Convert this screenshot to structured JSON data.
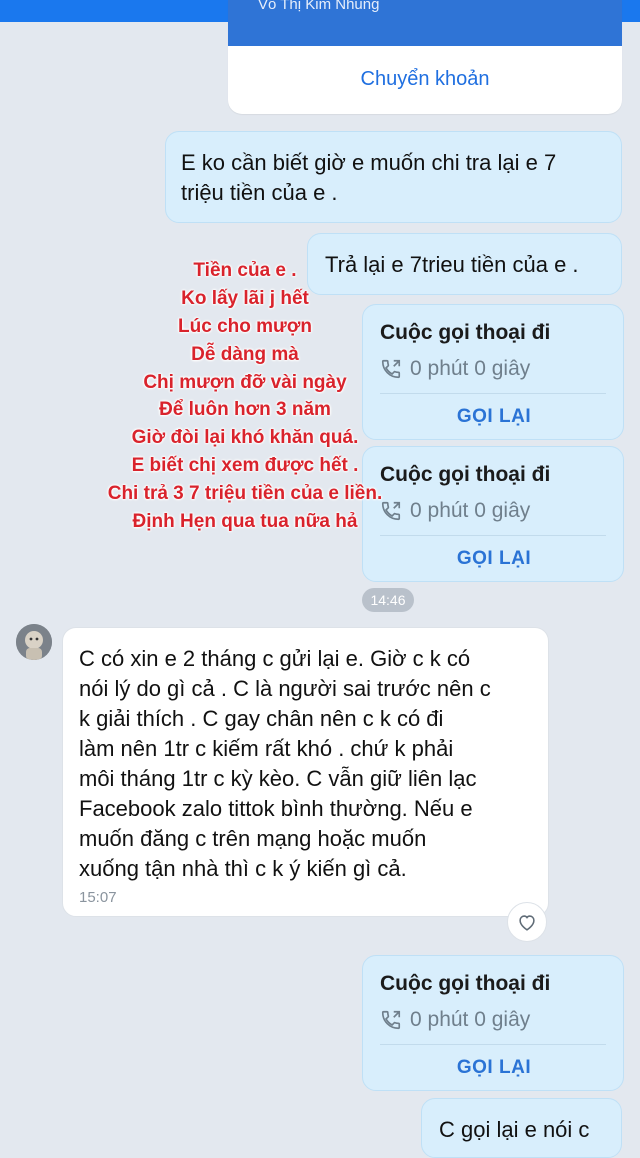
{
  "top_bar": {
    "cut_text": ""
  },
  "transfer": {
    "header_text": "Võ Thị Kim Nhung",
    "action_label": "Chuyển khoản"
  },
  "messages": {
    "m1": {
      "line1": "E ko cần biết giờ e muốn chi tra lại e 7",
      "line2": "triệu tiền của e ."
    },
    "m2": {
      "text": "Trả lại e 7trieu tiền của e ."
    },
    "call1": {
      "title": "Cuộc gọi thoại đi",
      "duration": "0 phút 0 giây",
      "action": "GỌI LẠI"
    },
    "call2": {
      "title": "Cuộc gọi thoại đi",
      "duration": "0 phút 0 giây",
      "action": "GỌI LẠI"
    },
    "time_badge": "14:46",
    "received": {
      "lines": [
        "C có xin e 2 tháng c gửi lại e. Giờ c k có",
        "nói lý do gì cả . C là người sai trước nên c",
        "k giải thích . C gay chân nên c k có đi",
        "làm nên 1tr c kiếm rất khó . chứ k phải",
        "môi tháng 1tr c kỳ kèo.  C vẫn giữ liên lạc",
        "Facebook zalo tittok bình thường. Nếu e",
        "muốn đăng c trên mạng hoặc muốn",
        "xuống tận nhà thì c k ý kiến gì cả."
      ],
      "time": "15:07"
    },
    "call3": {
      "title": "Cuộc gọi thoại đi",
      "duration": "0 phút 0 giây",
      "action": "GỌI LẠI"
    },
    "partial": {
      "text": "C gọi lại e nói c"
    }
  },
  "overlay": {
    "lines": [
      "Tiền của e .",
      "Ko lấy lãi j hết",
      "Lúc cho mượn",
      "Dễ dàng mà",
      "Chị mượn đỡ vài ngày",
      "Để luôn hơn 3 năm",
      "Giờ đòi lại khó khăn quá.",
      "E biết chị xem được hết .",
      "Chi trả 3 7 triệu tiền của e liền.",
      "Định Hẹn qua tua nữa hả"
    ]
  },
  "icons": {
    "call": "phone-outgoing-icon",
    "heart": "heart-outline-icon",
    "avatar": "avatar-image"
  },
  "colors": {
    "sent_bubble": "#d8eefc",
    "received_bubble": "#ffffff",
    "accent": "#2a73d5",
    "overlay_text": "#d9232c",
    "background": "#e3e8ef"
  }
}
